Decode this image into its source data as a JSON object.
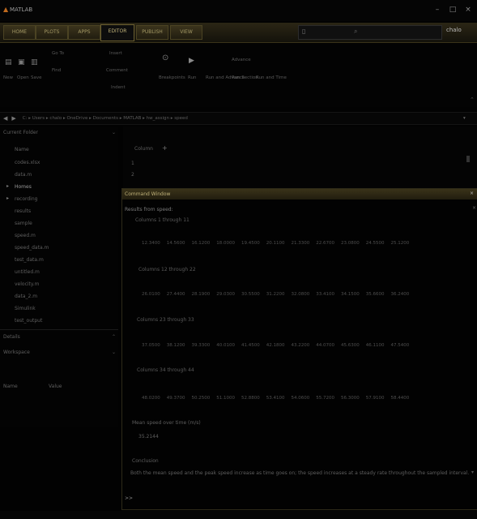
{
  "window": {
    "title": "MATLAB"
  },
  "tabs": [
    {
      "label": "HOME"
    },
    {
      "label": "PLOTS"
    },
    {
      "label": "APPS"
    },
    {
      "label": "EDITOR",
      "active": true
    },
    {
      "label": "PUBLISH"
    },
    {
      "label": "VIEW"
    }
  ],
  "user": "chalo",
  "ribbon": {
    "file": [
      "New",
      "Open",
      "Save"
    ],
    "navigate": [
      "Go To",
      "Find"
    ],
    "edit": [
      "Insert",
      "Comment",
      "Indent"
    ],
    "breakpoints": "Breakpoints",
    "run": [
      "Run",
      "Run and Advance",
      "Run Section",
      "Advance",
      "Run and Time"
    ]
  },
  "breadcrumb": [
    "C:",
    "Users",
    "chalo",
    "OneDrive",
    "Documents",
    "MATLAB",
    "hw_assign",
    "speed"
  ],
  "tree": {
    "header": "Current Folder",
    "items": [
      "Name",
      "codes.xlsx",
      "data.m",
      "Homes",
      "recording",
      "results",
      "sample",
      "speed.m",
      "speed_data.m",
      "test_data.m",
      "untitled.m",
      "velocity.m",
      "data_2.m",
      "Simulink",
      "test_output"
    ]
  },
  "left_bottom": {
    "details": "Details",
    "workspace": "Workspace",
    "var_header": "Name",
    "var_value": "Value"
  },
  "doc": {
    "header": "Column",
    "rows": [
      "1",
      "2"
    ]
  },
  "console": {
    "title": "Command Window",
    "path_prompt": "Results from speed:",
    "sections": [
      {
        "label": "Columns 1 through 11",
        "cells": [
          "12.3400",
          "14.5600",
          "16.1200",
          "18.0000",
          "19.4500",
          "20.1100",
          "21.3300",
          "22.6700",
          "23.0800",
          "24.5500",
          "25.1200"
        ]
      },
      {
        "label": "Columns 12 through 22",
        "cells": [
          "26.0100",
          "27.4400",
          "28.1900",
          "29.0300",
          "30.5500",
          "31.2200",
          "32.0800",
          "33.4100",
          "34.1500",
          "35.6600",
          "36.2400"
        ]
      },
      {
        "label": "Columns 23 through 33",
        "cells": [
          "37.0500",
          "38.1200",
          "39.3300",
          "40.0100",
          "41.4500",
          "42.1800",
          "43.2200",
          "44.0700",
          "45.6300",
          "46.1100",
          "47.5400"
        ]
      },
      {
        "label": "Columns 34 through 44",
        "cells": [
          "48.0200",
          "49.3700",
          "50.2500",
          "51.1000",
          "52.8800",
          "53.4100",
          "54.0600",
          "55.7200",
          "56.3000",
          "57.9100",
          "58.4400"
        ]
      }
    ],
    "mean_label": "Mean speed over time (m/s)",
    "mean_value": "35.2144",
    "conclusion_label": "Conclusion",
    "conclusion": "Both the mean speed and the peak speed increase as time goes on; the speed increases at a steady rate throughout the sampled interval.",
    "prompt": ">>"
  }
}
